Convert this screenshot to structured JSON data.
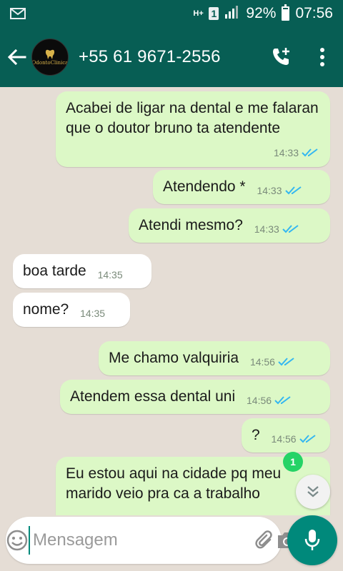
{
  "status_bar": {
    "network_type": "H+",
    "sim_slot": "1",
    "battery": "92%",
    "time": "07:56"
  },
  "header": {
    "contact_name": "+55 61 9671-2556",
    "avatar_brand": "OdontoClinica"
  },
  "messages": [
    {
      "direction": "out",
      "text": "Acabei de ligar na dental e me falaran que o doutor bruno ta atendente",
      "time": "14:33",
      "status": "read"
    },
    {
      "direction": "out",
      "text": "Atendendo *",
      "time": "14:33",
      "status": "read"
    },
    {
      "direction": "out",
      "text": "Atendi mesmo?",
      "time": "14:33",
      "status": "read"
    },
    {
      "direction": "in",
      "text": "boa tarde",
      "time": "14:35"
    },
    {
      "direction": "in",
      "text": "nome?",
      "time": "14:35"
    },
    {
      "direction": "out",
      "text": "Me chamo valquiria",
      "time": "14:56",
      "status": "read"
    },
    {
      "direction": "out",
      "text": "Atendem essa dental uni",
      "time": "14:56",
      "status": "read"
    },
    {
      "direction": "out",
      "text": "?",
      "time": "14:56",
      "status": "read"
    },
    {
      "direction": "out",
      "text": "Eu estou aqui na cidade pq meu marido veio pra ca a trabalho",
      "time": "",
      "status": ""
    }
  ],
  "unread_count": "1",
  "composer": {
    "placeholder": "Mensagem"
  },
  "colors": {
    "header": "#075e54",
    "outgoing_bubble": "#dcf8c6",
    "incoming_bubble": "#ffffff",
    "read_ticks": "#34b7f1",
    "accent": "#00897b",
    "chat_background": "#e5ddd5"
  },
  "icons": {
    "status_left": "mail-icon",
    "back": "arrow-left-icon",
    "call": "add-call-icon",
    "more": "more-vertical-icon",
    "emoji": "emoji-icon",
    "attach": "paperclip-icon",
    "camera": "camera-icon",
    "mic": "microphone-icon",
    "scroll": "double-chevron-down-icon"
  }
}
